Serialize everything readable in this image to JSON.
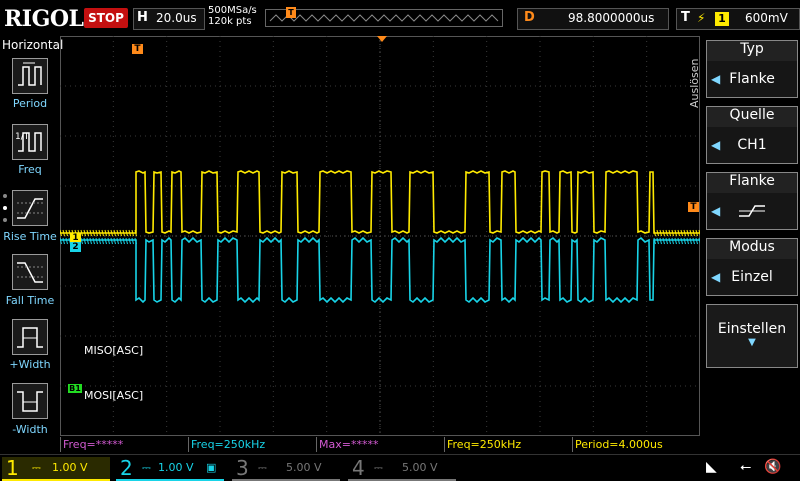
{
  "header": {
    "brand": "RIGOL",
    "run_state": "STOP",
    "timebase_label": "H",
    "timebase_value": "20.0us",
    "sample_rate": "500MSa/s",
    "memory_depth": "120k pts",
    "trigger_pos_marker": "T",
    "delay_label": "D",
    "delay_value": "98.8000000us",
    "trigger_label": "T",
    "trigger_channel": "1",
    "trigger_level": "600mV"
  },
  "left_panel": {
    "title": "Horizontal",
    "items": [
      {
        "label": "Period",
        "icon": "period-icon"
      },
      {
        "label": "Freq",
        "icon": "freq-icon"
      },
      {
        "label": "Rise Time",
        "icon": "rise-time-icon"
      },
      {
        "label": "Fall Time",
        "icon": "fall-time-icon"
      },
      {
        "label": "+Width",
        "icon": "pos-width-icon"
      },
      {
        "label": "-Width",
        "icon": "neg-width-icon"
      }
    ]
  },
  "right_menu": {
    "side_label": "Auslösen",
    "items": [
      {
        "header": "Typ",
        "value": "Flanke"
      },
      {
        "header": "Quelle",
        "value": "CH1"
      },
      {
        "header": "Flanke",
        "value": ""
      },
      {
        "header": "Modus",
        "value": "Einzel"
      }
    ],
    "settings_label": "Einstellen"
  },
  "screen": {
    "ch1_tag": "1",
    "ch2_tag": "2",
    "trigger_level_tag": "T",
    "bus_tag": "B1",
    "miso_label": "MISO[ASC]",
    "mosi_label": "MOSI[ASC]"
  },
  "measurements": [
    {
      "text": "Freq=*****",
      "color": "#d25ad2"
    },
    {
      "text": "Freq=250kHz",
      "color": "#18d4e8"
    },
    {
      "text": "Max=*****",
      "color": "#d25ad2"
    },
    {
      "text": "Freq=250kHz",
      "color": "#ffea00"
    },
    {
      "text": "Period=4.000us",
      "color": "#ffea00"
    }
  ],
  "channels": [
    {
      "num": "1",
      "scale": "1.00 V",
      "color": "#ffea00",
      "active": true
    },
    {
      "num": "2",
      "scale": "1.00 V",
      "color": "#18d4e8",
      "active": true
    },
    {
      "num": "3",
      "scale": "5.00 V",
      "color": "#777777",
      "active": false
    },
    {
      "num": "4",
      "scale": "5.00 V",
      "color": "#777777",
      "active": false
    }
  ],
  "colors": {
    "ch1": "#ffea00",
    "ch2": "#18d4e8",
    "trigger": "#ff8a1a",
    "bus": "#22dd22"
  }
}
